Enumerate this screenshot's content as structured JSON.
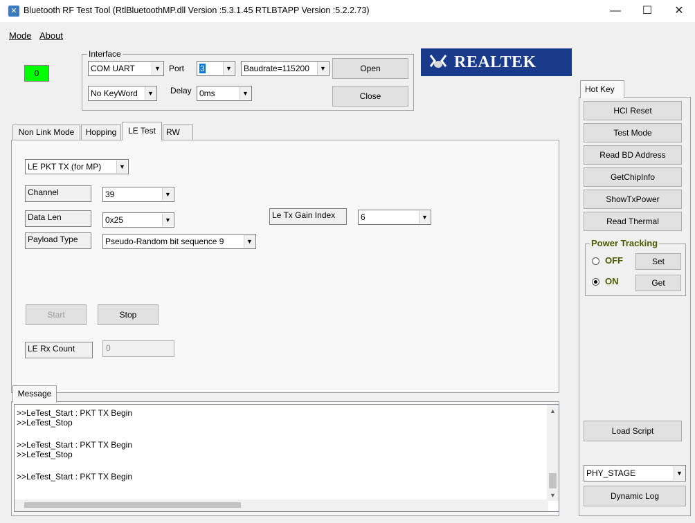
{
  "window": {
    "title": "Bluetooth RF Test Tool (RtlBluetoothMP.dll Version :5.3.1.45   RTLBTAPP Version :5.2.2.73)",
    "minimize": "—",
    "maximize": "☐",
    "close": "✕"
  },
  "menu": {
    "mode": "Mode",
    "about": "About"
  },
  "status_indicator": {
    "value": "0",
    "color": "#00ff00"
  },
  "interface": {
    "label": "Interface",
    "type": "COM UART",
    "port_label": "Port",
    "port": "3",
    "baudrate": "Baudrate=115200",
    "open": "Open",
    "keyword": "No KeyWord",
    "delay_label": "Delay",
    "delay": "0ms",
    "close": "Close"
  },
  "logo": {
    "text": "REALTEK",
    "color": "#1a3a8c"
  },
  "tabs": [
    "Non Link Mode",
    "Hopping",
    "LE Test",
    "RW"
  ],
  "le_test": {
    "mode": "LE PKT TX (for MP)",
    "channel_label": "Channel",
    "channel": "39",
    "data_len_label": "Data Len",
    "data_len": "0x25",
    "payload_label": "Payload Type",
    "payload": "Pseudo-Random bit sequence 9",
    "gain_label": "Le Tx Gain Index",
    "gain": "6",
    "start": "Start",
    "stop": "Stop",
    "rx_label": "LE Rx Count",
    "rx_value": "0"
  },
  "message": {
    "tab": "Message",
    "lines": [
      ">>LeTest_Start : PKT TX Begin",
      ">>LeTest_Stop",
      "",
      ">>LeTest_Start : PKT TX Begin",
      ">>LeTest_Stop",
      "",
      ">>LeTest_Start : PKT TX Begin"
    ]
  },
  "hotkey": {
    "tab": "Hot Key",
    "buttons": [
      "HCI Reset",
      "Test Mode",
      "Read BD Address",
      "GetChipInfo",
      "ShowTxPower",
      "Read Thermal"
    ],
    "power_tracking": {
      "label": "Power Tracking",
      "label_color": "#4a5a00",
      "off": "OFF",
      "on": "ON",
      "selected": "ON",
      "set": "Set",
      "get": "Get"
    },
    "load_script": "Load Script",
    "stage": "PHY_STAGE",
    "dynamic_log": "Dynamic Log"
  }
}
